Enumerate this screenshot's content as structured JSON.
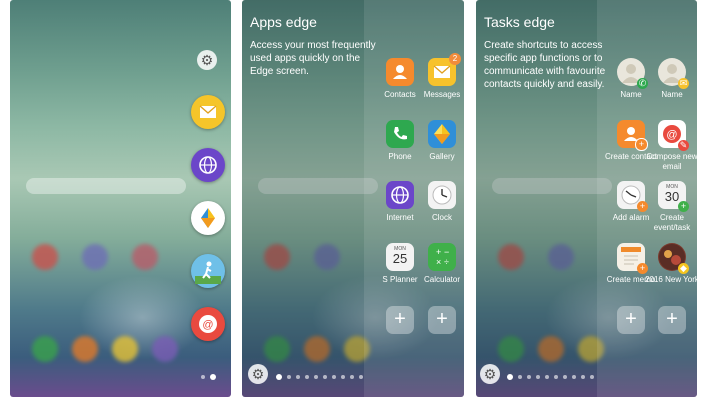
{
  "panel1": {
    "edge_icons": [
      "gear-icon",
      "email-icon",
      "internet-icon",
      "gallery-icon",
      "fitness-icon",
      "email-red-icon"
    ]
  },
  "panel2": {
    "title": "Apps edge",
    "description": "Access your most frequently used apps quickly on the Edge screen.",
    "apps": [
      {
        "label": "Contacts",
        "icon": "contacts-icon",
        "color": "#f58a2d"
      },
      {
        "label": "Messages",
        "icon": "messages-icon",
        "color": "#f7c22c",
        "badge": "2"
      },
      {
        "label": "Phone",
        "icon": "phone-icon",
        "color": "#2ea84f"
      },
      {
        "label": "Gallery",
        "icon": "gallery-icon",
        "color": "#f5c51f"
      },
      {
        "label": "Internet",
        "icon": "internet-icon",
        "color": "#6b46c9"
      },
      {
        "label": "Clock",
        "icon": "clock-icon",
        "color": "#f3f3f3"
      },
      {
        "label": "S Planner",
        "icon": "calendar-icon",
        "color": "#f3f3f3",
        "month": "MON",
        "day": "25"
      },
      {
        "label": "Calculator",
        "icon": "calculator-icon",
        "color": "#3fb04a"
      }
    ]
  },
  "panel3": {
    "title": "Tasks edge",
    "description": "Create shortcuts to access specific app functions or to communicate with favourite contacts quickly and easily.",
    "tasks": [
      {
        "label": "Name",
        "icon": "contact-call-icon"
      },
      {
        "label": "Name",
        "icon": "contact-message-icon"
      },
      {
        "label": "Create contact",
        "icon": "create-contact-icon"
      },
      {
        "label": "Compose new email",
        "icon": "compose-email-icon"
      },
      {
        "label": "Add alarm",
        "icon": "add-alarm-icon"
      },
      {
        "label": "Create event/task",
        "icon": "create-event-icon",
        "month": "MON",
        "day": "30"
      },
      {
        "label": "Create memo",
        "icon": "create-memo-icon"
      },
      {
        "label": "2016 New York",
        "icon": "photo-album-icon"
      }
    ]
  }
}
